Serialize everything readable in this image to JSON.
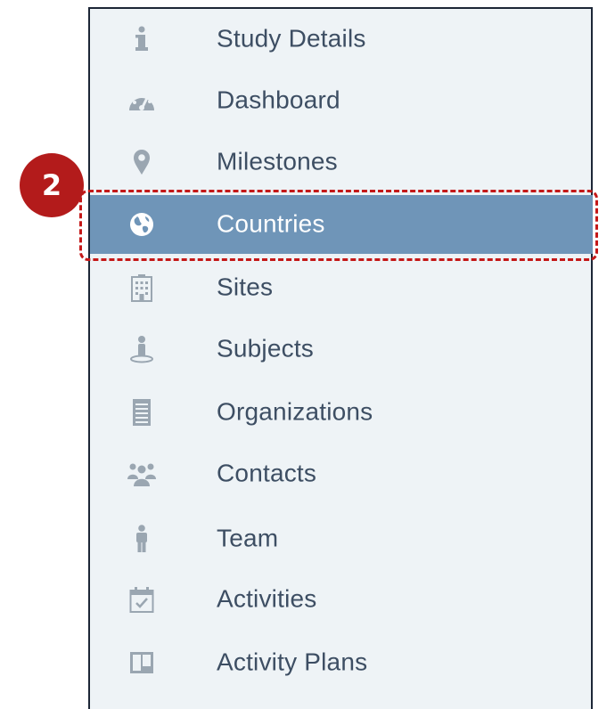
{
  "nav": {
    "items": [
      {
        "label": "Study Details",
        "icon": "info-icon"
      },
      {
        "label": "Dashboard",
        "icon": "dashboard-gauge-icon"
      },
      {
        "label": "Milestones",
        "icon": "map-pin-icon"
      },
      {
        "label": "Countries",
        "icon": "globe-icon",
        "active": true
      },
      {
        "label": "Sites",
        "icon": "building-icon"
      },
      {
        "label": "Subjects",
        "icon": "person-on-pedestal-icon"
      },
      {
        "label": "Organizations",
        "icon": "document-list-icon"
      },
      {
        "label": "Contacts",
        "icon": "group-people-icon"
      },
      {
        "label": "Team",
        "icon": "person-icon"
      },
      {
        "label": "Activities",
        "icon": "calendar-check-icon"
      },
      {
        "label": "Activity Plans",
        "icon": "book-icon"
      }
    ]
  },
  "annotation": {
    "step_number": "2"
  },
  "colors": {
    "panel_background": "#eef3f6",
    "active_background": "#6f95b8",
    "label_text": "#3d4e63",
    "icon_gray": "#9aa6b1",
    "annotation_red": "#b31b1b"
  }
}
